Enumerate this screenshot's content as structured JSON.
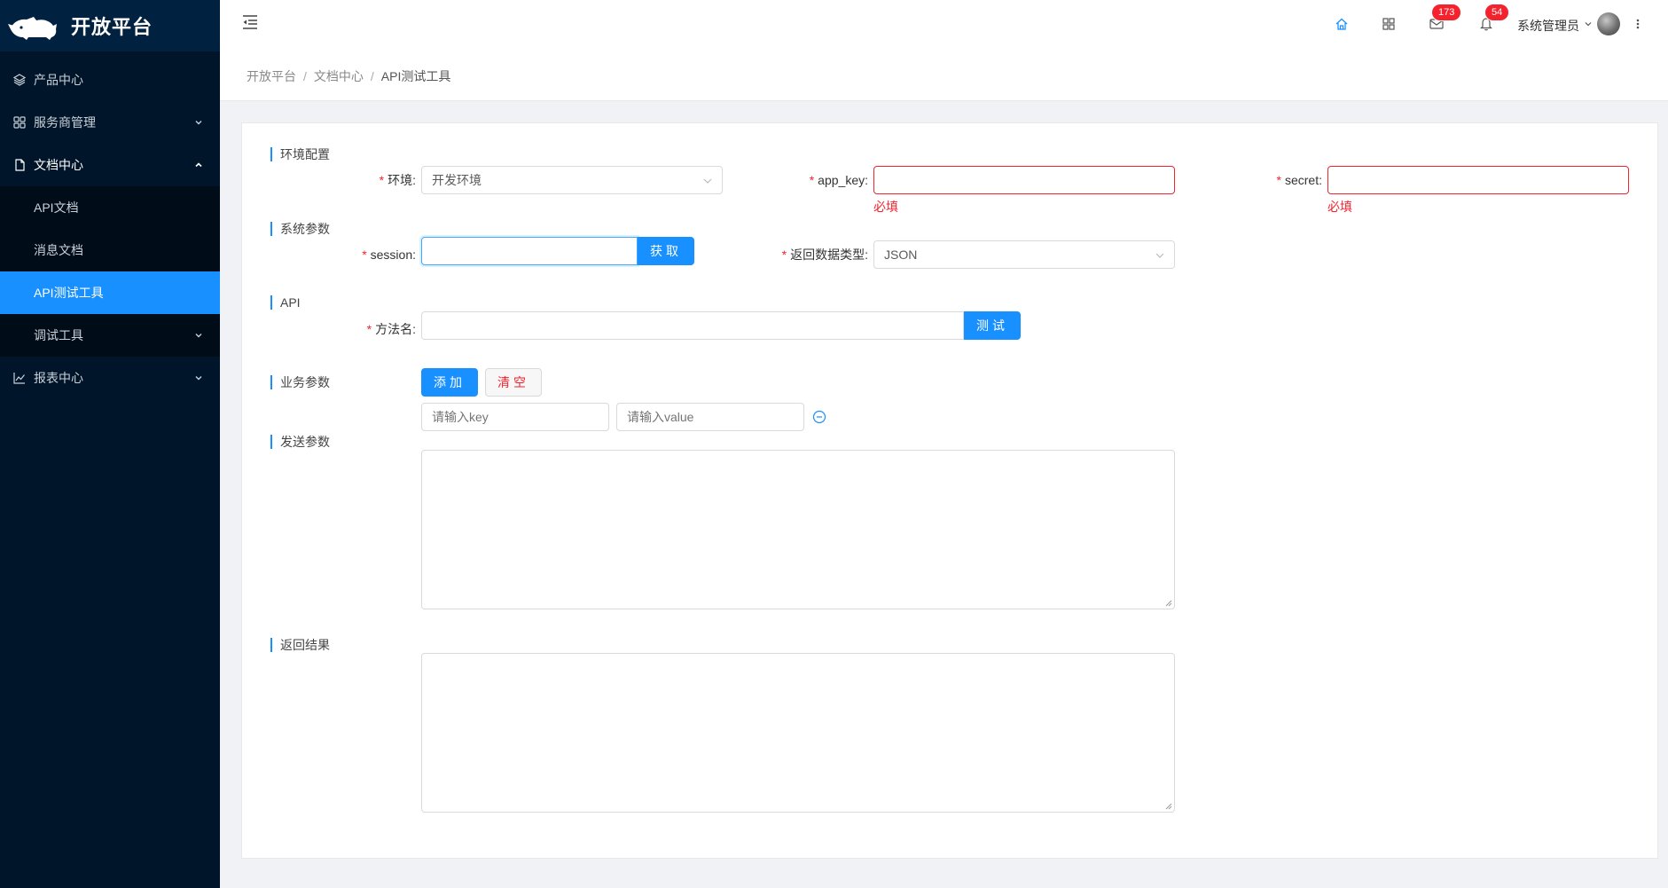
{
  "app": {
    "title": "开放平台"
  },
  "sidebar": {
    "items": [
      {
        "label": "产品中心",
        "icon": "layers-icon"
      },
      {
        "label": "服务商管理",
        "icon": "apps-icon"
      },
      {
        "label": "文档中心",
        "icon": "file-icon"
      },
      {
        "label": "报表中心",
        "icon": "line-chart-icon"
      }
    ],
    "sub_items": [
      {
        "label": "API文档"
      },
      {
        "label": "消息文档"
      },
      {
        "label": "API测试工具",
        "active": true
      },
      {
        "label": "调试工具"
      }
    ]
  },
  "header": {
    "mail_count": "173",
    "notice_count": "54",
    "user_name": "系统管理员"
  },
  "breadcrumb": [
    "开放平台",
    "文档中心",
    "API测试工具"
  ],
  "form": {
    "env_section": "环境配置",
    "env_label": "环境",
    "env_value": "开发环境",
    "app_key_label": "app_key",
    "secret_label": "secret",
    "required_msg": "必填",
    "sys_section": "系统参数",
    "session_label": "session",
    "fetch_button": "获取",
    "return_type_label": "返回数据类型",
    "return_type_value": "JSON",
    "api_section": "API",
    "method_label": "方法名",
    "test_button": "测试",
    "biz_section": "业务参数",
    "add_button": "添加",
    "clear_button": "清空",
    "key_placeholder": "请输入key",
    "value_placeholder": "请输入value",
    "send_section": "发送参数",
    "result_section": "返回结果"
  },
  "colors": {
    "sidebar_bg": "#001529",
    "primary": "#1890ff",
    "error": "#f5222d"
  }
}
